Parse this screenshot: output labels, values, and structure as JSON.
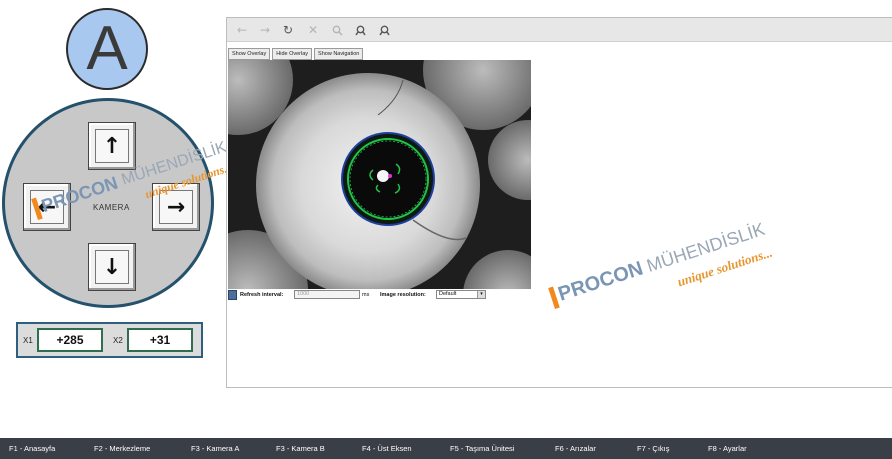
{
  "camera_badge": {
    "letter": "A"
  },
  "jog": {
    "up": "↑",
    "down": "↓",
    "left": "←",
    "right": "→",
    "center_label": "KAMERA"
  },
  "watermark": {
    "brand": "PROCON",
    "brand2": "MÜHENDİSLİK",
    "tagline": "unique solutions..."
  },
  "coords": {
    "x1_label": "X1",
    "x1_value": "+285",
    "x2_label": "X2",
    "x2_value": "+31"
  },
  "browser": {
    "toolbar": {
      "back_icon": "arrow-left-icon",
      "forward_icon": "arrow-right-icon",
      "reload_icon": "reload-icon",
      "stop_icon": "close-icon",
      "zoom_icon": "magnifier-icon",
      "zoom_in_icon": "zoom-in-icon",
      "zoom_out_icon": "zoom-out-icon"
    },
    "overlay_buttons": [
      "Show Overlay",
      "Hide Overlay",
      "Show Navigation"
    ],
    "refresh_label": "Refresh interval:",
    "refresh_value": "1000",
    "refresh_unit": "ms",
    "resolution_label": "Image resolution:",
    "resolution_value": "Default"
  },
  "footer": {
    "items": [
      "F1 - Anasayfa",
      "F2 - Merkezleme",
      "F3 - Kamera  A",
      "F3 - Kamera  B",
      "F4 - Üst Eksen",
      "F5 - Taşıma Ünitesi",
      "F6 - Arızalar",
      "F7 - Çıkış",
      "F8 - Ayarlar"
    ]
  },
  "colors": {
    "badge": "#a9c8f0",
    "jog_ring": "#24516c",
    "footer_bg": "#3a3f47",
    "overlay_green": "#22c24a",
    "overlay_blue": "#1f3f9e",
    "watermark_orange": "#f08a1c"
  }
}
